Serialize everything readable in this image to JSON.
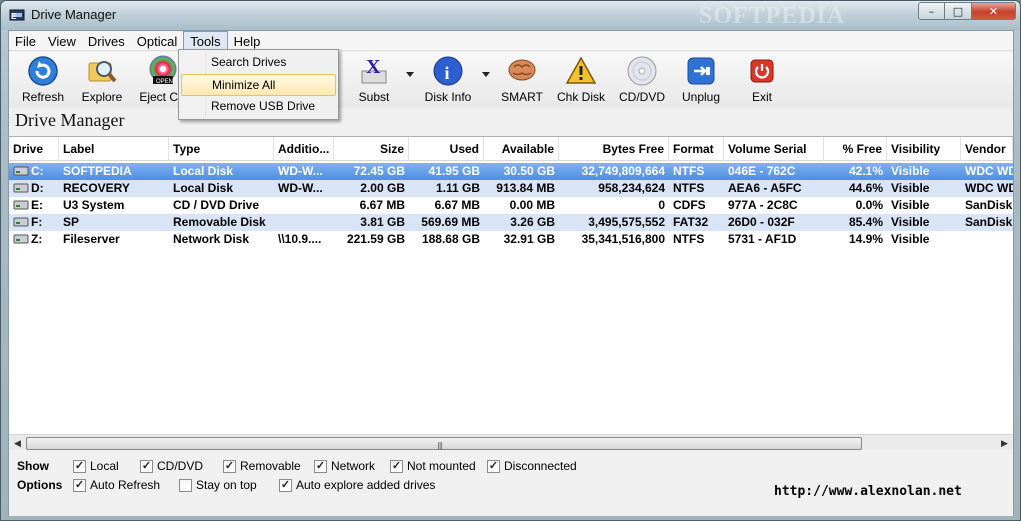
{
  "window": {
    "title": "Drive Manager",
    "watermark": "SOFTPEDIA"
  },
  "caption_buttons": {
    "minimize": "–",
    "maximize": "□",
    "close": "✕"
  },
  "menubar": [
    "File",
    "View",
    "Drives",
    "Optical",
    "Tools",
    "Help"
  ],
  "tools_menu": [
    "Search Drives",
    "Minimize All",
    "Remove USB Drive"
  ],
  "toolbar": {
    "refresh": "Refresh",
    "explore": "Explore",
    "eject": "Eject CD",
    "subst": "Subst",
    "disk_info": "Disk Info",
    "smart": "SMART",
    "chk_disk": "Chk Disk",
    "cd_dvd": "CD/DVD",
    "unplug": "Unplug",
    "exit": "Exit"
  },
  "heading": "Drive Manager",
  "columns": [
    "Drive",
    "Label",
    "Type",
    "Additio...",
    "Size",
    "Used",
    "Available",
    "Bytes Free",
    "Format",
    "Volume Serial",
    "% Free",
    "Visibility",
    "Vendor"
  ],
  "rows": [
    [
      "C:",
      "SOFTPEDIA",
      "Local Disk",
      "WD-W...",
      "72.45 GB",
      "41.95 GB",
      "30.50 GB",
      "32,749,809,664",
      "NTFS",
      "046E - 762C",
      "42.1%",
      "Visible",
      "WDC WD"
    ],
    [
      "D:",
      "RECOVERY",
      "Local Disk",
      "WD-W...",
      "2.00 GB",
      "1.11 GB",
      "913.84 MB",
      "958,234,624",
      "NTFS",
      "AEA6 - A5FC",
      "44.6%",
      "Visible",
      "WDC WD"
    ],
    [
      "E:",
      "U3 System",
      "CD / DVD Drive",
      "",
      "6.67 MB",
      "6.67 MB",
      "0.00 MB",
      "0",
      "CDFS",
      "977A - 2C8C",
      "0.0%",
      "Visible",
      "SanDisk"
    ],
    [
      "F:",
      "SP",
      "Removable Disk",
      "",
      "3.81 GB",
      "569.69 MB",
      "3.26 GB",
      "3,495,575,552",
      "FAT32",
      "26D0 - 032F",
      "85.4%",
      "Visible",
      "SanDisk"
    ],
    [
      "Z:",
      "Fileserver",
      "Network Disk",
      "\\\\10.9....",
      "221.59 GB",
      "188.68 GB",
      "32.91 GB",
      "35,341,516,800",
      "NTFS",
      "5731 - AF1D",
      "14.9%",
      "Visible",
      ""
    ]
  ],
  "show": {
    "label": "Show",
    "items": [
      {
        "label": "Local",
        "checked": true
      },
      {
        "label": "CD/DVD",
        "checked": true
      },
      {
        "label": "Removable",
        "checked": true
      },
      {
        "label": "Network",
        "checked": true
      },
      {
        "label": "Not mounted",
        "checked": true
      },
      {
        "label": "Disconnected",
        "checked": true
      }
    ]
  },
  "options": {
    "label": "Options",
    "items": [
      {
        "label": "Auto Refresh",
        "checked": true
      },
      {
        "label": "Stay on top",
        "checked": false
      },
      {
        "label": "Auto explore added drives",
        "checked": true
      }
    ]
  },
  "url": "http://www.alexnolan.net",
  "colors": {
    "selection": "#4c8fe4",
    "alt_row": "#d9e4f7",
    "menu_highlight": "#fde9b0"
  }
}
